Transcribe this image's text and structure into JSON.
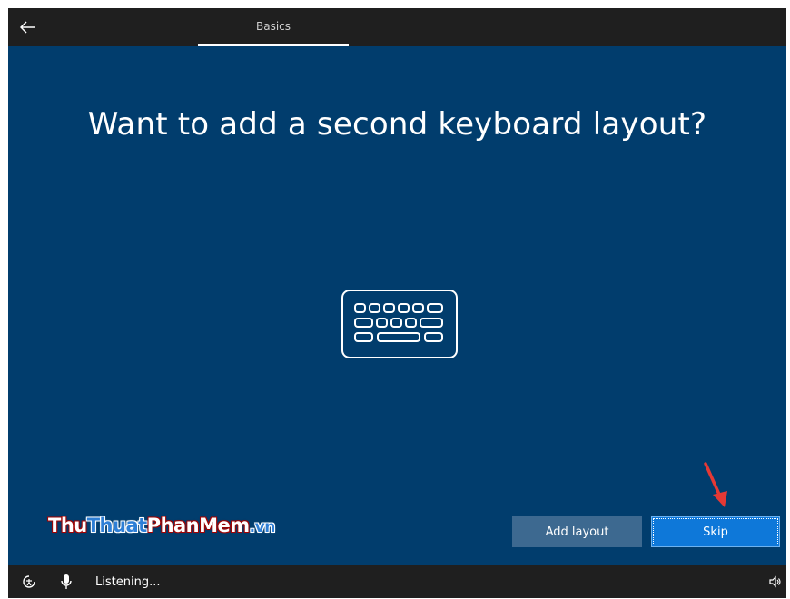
{
  "header": {
    "tab_label": "Basics"
  },
  "main": {
    "question": "Want to add a second keyboard layout?",
    "icon": "keyboard-icon"
  },
  "watermark": {
    "part1": "Thu",
    "part2": "Thuat",
    "part3": "PhanMem",
    "part4": ".vn"
  },
  "actions": {
    "add_layout_label": "Add layout",
    "skip_label": "Skip"
  },
  "footer": {
    "status_text": "Listening..."
  },
  "colors": {
    "background": "#013d6d",
    "bar": "#1f1f1f",
    "primary_button": "#0e78d9",
    "secondary_button": "#3d6990",
    "annotation_arrow": "#e53935"
  }
}
